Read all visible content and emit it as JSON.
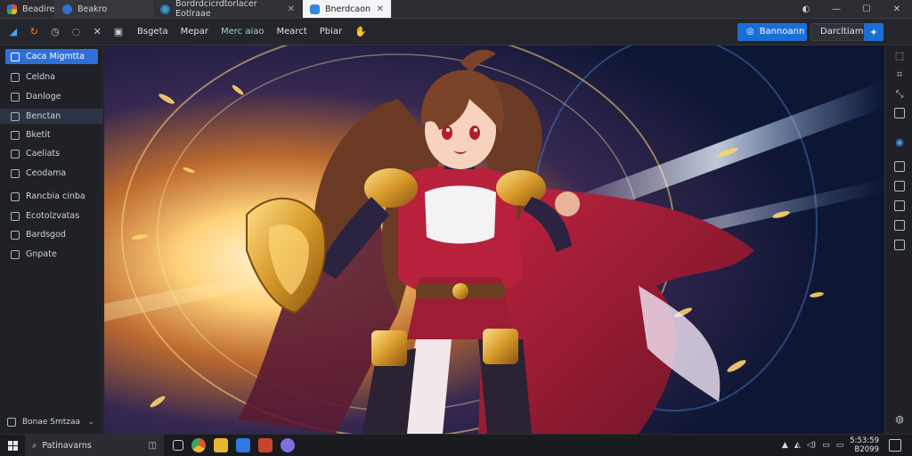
{
  "tabs": [
    {
      "label": "Beadirebe",
      "icon": "app-icon",
      "color": "#e2562d"
    },
    {
      "label": "Beakro",
      "icon": "browser-icon",
      "color": "#2f6fd6"
    },
    {
      "label": "Bordrdcicrdtorlacer Eotlraae",
      "icon": "puzzle-icon",
      "color": "#4aa37a"
    },
    {
      "label": "Bnerdcaon",
      "icon": "image-icon",
      "color": "#2f8ae0"
    }
  ],
  "window": {
    "minimize": "—",
    "maximize": "☐",
    "close": "✕"
  },
  "toolbar": {
    "nav": [
      "Bsgeta",
      "Mepar",
      "Merc aiao",
      "Mearct",
      "Pbiar"
    ],
    "primary_button": "Bannoann",
    "secondary_button": "Darcltiamtan"
  },
  "sidebar": {
    "items": [
      {
        "label": "Caca Migmtta"
      },
      {
        "label": "Celdna"
      },
      {
        "label": "Danloge"
      },
      {
        "label": "Benctan"
      },
      {
        "label": "Bketit"
      },
      {
        "label": "Caeliats"
      },
      {
        "label": "Ceodama"
      },
      {
        "label": "Rancbia cinba"
      },
      {
        "label": "Ecotolzvatas"
      },
      {
        "label": "Bardsgod"
      },
      {
        "label": "Gnpate"
      }
    ],
    "footer": "Bonae Smtzaa"
  },
  "taskbar": {
    "search_placeholder": "Patinavarns",
    "clock_time": "5:53:59",
    "clock_date": "B2099"
  },
  "colors": {
    "accent": "#1a6fd6",
    "sidebar_active": "#2e6fd8",
    "background": "#1b1d22"
  }
}
